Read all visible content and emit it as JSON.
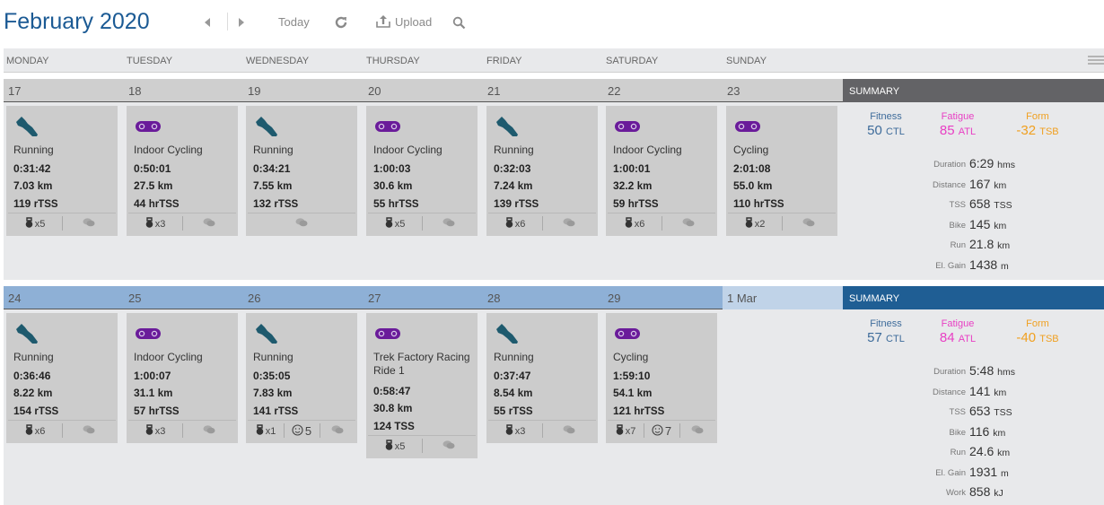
{
  "header": {
    "month": "February",
    "year": "2020",
    "today_label": "Today",
    "upload_label": "Upload"
  },
  "weekdays": [
    "MONDAY",
    "TUESDAY",
    "WEDNESDAY",
    "THURSDAY",
    "FRIDAY",
    "SATURDAY",
    "SUNDAY"
  ],
  "colors": {
    "running_icon": "#1e5a6e",
    "cycling_icon": "#6a1b9a",
    "fitness": "#3d6b9a",
    "fatigue": "#e83fc4",
    "form": "#f0a020",
    "title": "#1b5a94"
  },
  "weeks": [
    {
      "days": [
        "17",
        "18",
        "19",
        "20",
        "21",
        "22",
        "23"
      ],
      "summary_label": "SUMMARY",
      "activities": [
        {
          "sport": "running",
          "title": "Running",
          "duration": "0:31:42",
          "distance": "7.03",
          "distance_unit": "km",
          "tss": "119",
          "tss_unit": "rTSS",
          "footer": [
            {
              "icon": "kettlebell-icon",
              "text": "x5"
            },
            {
              "icon": "comment-icon",
              "text": ""
            }
          ]
        },
        {
          "sport": "cycling",
          "title": "Indoor Cycling",
          "duration": "0:50:01",
          "distance": "27.5",
          "distance_unit": "km",
          "tss": "44",
          "tss_unit": "hrTSS",
          "footer": [
            {
              "icon": "kettlebell-icon",
              "text": "x3"
            },
            {
              "icon": "comment-icon",
              "text": ""
            }
          ]
        },
        {
          "sport": "running",
          "title": "Running",
          "duration": "0:34:21",
          "distance": "7.55",
          "distance_unit": "km",
          "tss": "132",
          "tss_unit": "rTSS",
          "footer": [
            {
              "icon": "comment-icon",
              "text": ""
            }
          ]
        },
        {
          "sport": "cycling",
          "title": "Indoor Cycling",
          "duration": "1:00:03",
          "distance": "30.6",
          "distance_unit": "km",
          "tss": "55",
          "tss_unit": "hrTSS",
          "footer": [
            {
              "icon": "kettlebell-icon",
              "text": "x5"
            },
            {
              "icon": "comment-icon",
              "text": ""
            }
          ]
        },
        {
          "sport": "running",
          "title": "Running",
          "duration": "0:32:03",
          "distance": "7.24",
          "distance_unit": "km",
          "tss": "139",
          "tss_unit": "rTSS",
          "footer": [
            {
              "icon": "kettlebell-icon",
              "text": "x6"
            },
            {
              "icon": "comment-icon",
              "text": ""
            }
          ]
        },
        {
          "sport": "cycling",
          "title": "Indoor Cycling",
          "duration": "1:00:01",
          "distance": "32.2",
          "distance_unit": "km",
          "tss": "59",
          "tss_unit": "hrTSS",
          "footer": [
            {
              "icon": "kettlebell-icon",
              "text": "x6"
            },
            {
              "icon": "comment-icon",
              "text": ""
            }
          ]
        },
        {
          "sport": "cycling",
          "title": "Cycling",
          "duration": "2:01:08",
          "distance": "55.0",
          "distance_unit": "km",
          "tss": "110",
          "tss_unit": "hrTSS",
          "footer": [
            {
              "icon": "kettlebell-icon",
              "text": "x2"
            },
            {
              "icon": "comment-icon",
              "text": ""
            }
          ]
        }
      ],
      "summary": {
        "fitness_label": "Fitness",
        "fitness_value": "50",
        "fitness_unit": "CTL",
        "fatigue_label": "Fatigue",
        "fatigue_value": "85",
        "fatigue_unit": "ATL",
        "form_label": "Form",
        "form_value": "-32",
        "form_unit": "TSB",
        "rows": [
          {
            "label": "Duration",
            "value": "6:29",
            "unit": "hms"
          },
          {
            "label": "Distance",
            "value": "167",
            "unit": "km"
          },
          {
            "label": "TSS",
            "value": "658",
            "unit": "TSS"
          },
          {
            "label": "Bike",
            "value": "145",
            "unit": "km"
          },
          {
            "label": "Run",
            "value": "21.8",
            "unit": "km"
          },
          {
            "label": "El. Gain",
            "value": "1438",
            "unit": "m"
          }
        ]
      }
    },
    {
      "days": [
        "24",
        "25",
        "26",
        "27",
        "28",
        "29"
      ],
      "next_month_day": "1 Mar",
      "summary_label": "SUMMARY",
      "activities": [
        {
          "sport": "running",
          "title": "Running",
          "duration": "0:36:46",
          "distance": "8.22",
          "distance_unit": "km",
          "tss": "154",
          "tss_unit": "rTSS",
          "footer": [
            {
              "icon": "kettlebell-icon",
              "text": "x6"
            },
            {
              "icon": "comment-icon",
              "text": ""
            }
          ]
        },
        {
          "sport": "cycling",
          "title": "Indoor Cycling",
          "duration": "1:00:07",
          "distance": "31.1",
          "distance_unit": "km",
          "tss": "57",
          "tss_unit": "hrTSS",
          "footer": [
            {
              "icon": "kettlebell-icon",
              "text": "x3"
            },
            {
              "icon": "comment-icon",
              "text": ""
            }
          ]
        },
        {
          "sport": "running",
          "title": "Running",
          "duration": "0:35:05",
          "distance": "7.83",
          "distance_unit": "km",
          "tss": "141",
          "tss_unit": "rTSS",
          "footer": [
            {
              "icon": "kettlebell-icon",
              "text": "x1"
            },
            {
              "icon": "smiley-icon",
              "text": "5"
            },
            {
              "icon": "comment-icon",
              "text": ""
            }
          ]
        },
        {
          "sport": "cycling",
          "title": "Trek Factory Racing Ride 1",
          "duration": "0:58:47",
          "distance": "30.8",
          "distance_unit": "km",
          "tss": "124",
          "tss_unit": "TSS",
          "footer": [
            {
              "icon": "kettlebell-icon",
              "text": "x5"
            },
            {
              "icon": "comment-icon",
              "text": ""
            }
          ]
        },
        {
          "sport": "running",
          "title": "Running",
          "duration": "0:37:47",
          "distance": "8.54",
          "distance_unit": "km",
          "tss": "55",
          "tss_unit": "rTSS",
          "footer": [
            {
              "icon": "kettlebell-icon",
              "text": "x3"
            },
            {
              "icon": "comment-icon",
              "text": ""
            }
          ]
        },
        {
          "sport": "cycling",
          "title": "Cycling",
          "duration": "1:59:10",
          "distance": "54.1",
          "distance_unit": "km",
          "tss": "121",
          "tss_unit": "hrTSS",
          "footer": [
            {
              "icon": "kettlebell-icon",
              "text": "x7"
            },
            {
              "icon": "smiley-icon",
              "text": "7"
            },
            {
              "icon": "comment-icon",
              "text": ""
            }
          ]
        }
      ],
      "summary": {
        "fitness_label": "Fitness",
        "fitness_value": "57",
        "fitness_unit": "CTL",
        "fatigue_label": "Fatigue",
        "fatigue_value": "84",
        "fatigue_unit": "ATL",
        "form_label": "Form",
        "form_value": "-40",
        "form_unit": "TSB",
        "rows": [
          {
            "label": "Duration",
            "value": "5:48",
            "unit": "hms"
          },
          {
            "label": "Distance",
            "value": "141",
            "unit": "km"
          },
          {
            "label": "TSS",
            "value": "653",
            "unit": "TSS"
          },
          {
            "label": "Bike",
            "value": "116",
            "unit": "km"
          },
          {
            "label": "Run",
            "value": "24.6",
            "unit": "km"
          },
          {
            "label": "El. Gain",
            "value": "1931",
            "unit": "m"
          },
          {
            "label": "Work",
            "value": "858",
            "unit": "kJ"
          }
        ]
      }
    }
  ]
}
